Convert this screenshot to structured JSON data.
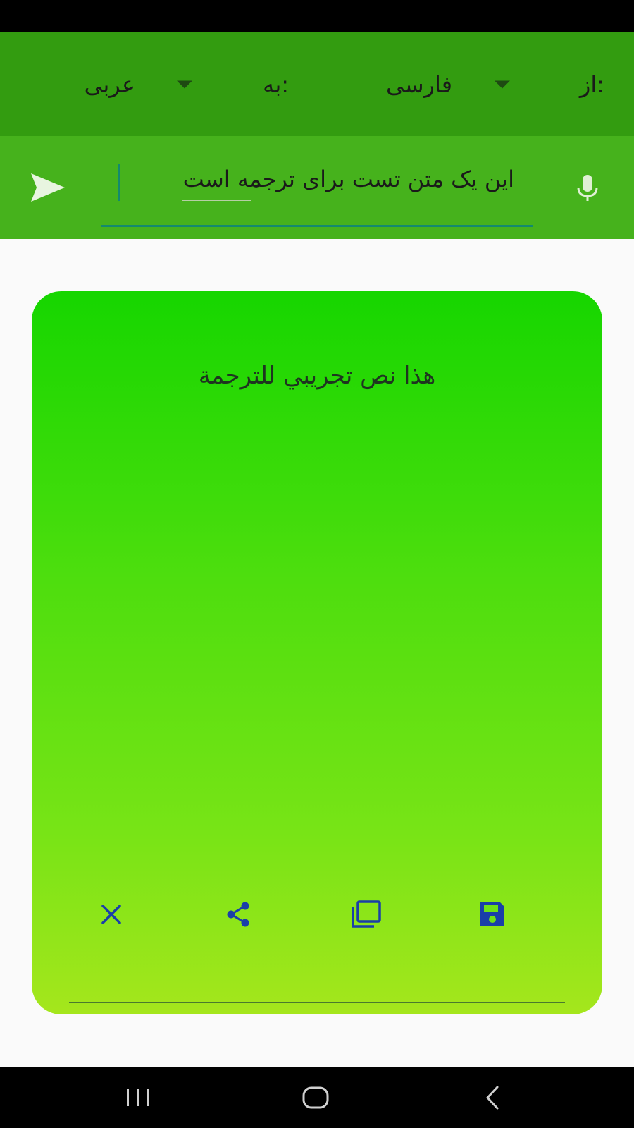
{
  "language_bar": {
    "from_label": "از:",
    "from_language": "فارسی",
    "to_label": "به:",
    "to_language": "عربی"
  },
  "input": {
    "value": "این یک متن تست برای ترجمه است"
  },
  "result": {
    "text": "هذا نص تجريبي للترجمة"
  },
  "icons": {
    "send": "send-icon",
    "mic": "microphone-icon",
    "clear": "close-icon",
    "share": "share-icon",
    "copy": "copy-icon",
    "save": "save-icon",
    "nav_recent": "recent-apps-icon",
    "nav_home": "home-icon",
    "nav_back": "back-icon"
  },
  "colors": {
    "language_bar": "#339c10",
    "input_bar": "#46b21c",
    "field_accent": "#138a6e",
    "card_top": "#16d600",
    "card_bottom": "#a5e61c",
    "action_icons": "#1a3fa8"
  }
}
